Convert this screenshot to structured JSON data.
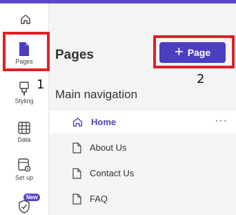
{
  "rail": {
    "items": [
      {
        "label": "Pages",
        "icon": "page-icon"
      },
      {
        "label": "Styling",
        "icon": "paintbrush-icon"
      },
      {
        "label": "Data",
        "icon": "table-icon"
      },
      {
        "label": "Set up",
        "icon": "settings-page-icon"
      },
      {
        "label": "",
        "icon": "shield-check-icon"
      }
    ],
    "badge": "New"
  },
  "main": {
    "title": "Pages",
    "add_button": {
      "icon": "plus",
      "label": "Page"
    },
    "section_title": "Main navigation",
    "nav_items": [
      {
        "label": "Home",
        "icon": "home-icon",
        "active": true
      },
      {
        "label": "About Us",
        "icon": "page-icon"
      },
      {
        "label": "Contact Us",
        "icon": "page-icon"
      },
      {
        "label": "FAQ",
        "icon": "page-icon"
      }
    ],
    "more_label": "···"
  },
  "annotations": {
    "one": "1",
    "two": "2"
  },
  "colors": {
    "accent": "#4b3fbf",
    "annotation": "#e21f26"
  }
}
